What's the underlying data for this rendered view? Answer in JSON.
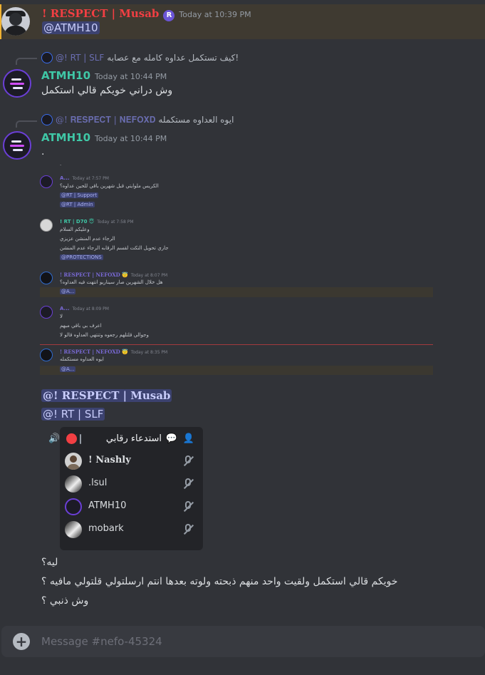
{
  "messages": [
    {
      "author": "! 𝐑𝐄𝐒𝐏𝐄𝐂𝐓 | Musab",
      "badge": "R",
      "time": "Today at 10:39 PM",
      "mention": "@ATMH10"
    },
    {
      "reply": {
        "name": "@! RT | SLF",
        "text": "كيف تستكمل عداوه كامله مع عصابه!"
      },
      "author": "ATMH10",
      "time": "Today at 10:44 PM",
      "text": "وش دراني خويكم قالي استكمل"
    },
    {
      "reply": {
        "name": "@! 𝐑𝐄𝐒𝐏𝐄𝐂𝐓 | 𝐍𝐄𝐅𝐎𝐗𝐃",
        "text": "ايوه العداوه مستكمله"
      },
      "author": "ATMH10",
      "time": "Today at 10:44 PM",
      "text": "."
    }
  ],
  "embed": {
    "top_dot": ".",
    "rows": [
      {
        "name": "A...",
        "time": "Today at 7:57 PM",
        "lines": [
          "الكريس ملوايتي قبل شهرين باقي للحين عداوه؟"
        ],
        "mentions": [
          "@RT | Support",
          "@RT | Admin"
        ]
      },
      {
        "name": "! RT | D70 😇",
        "time": "Today at 7:58 PM",
        "lines": [
          "وعليكم السلام",
          "الرجاء عدم المنشن عزيزي",
          "جاري تحويل التكت لقسم الرقابه الرجاء عدم المنشن"
        ],
        "mentions": [
          "@PROTECTIONS"
        ]
      },
      {
        "name": "! RESPECT | NEFOXD 😇",
        "time": "Today at 8:07 PM",
        "lines": [
          "هل خلال الشهرين صار سيناريو انتهت فيه العداوه؟"
        ],
        "mentions": [
          "@A..."
        ]
      },
      {
        "name": "A...",
        "time": "Today at 8:09 PM",
        "lines": [
          "لا",
          "اعرف بي باقي مبهم",
          "وجوالي قلتلهم رجعوه وتنتهي العداوه قالو لا"
        ],
        "mentions": []
      },
      {
        "name": "! RESPECT | NEFOXD 😇",
        "time": "Today at 8:35 PM",
        "lines": [
          "ايوه العداوه مستكمله"
        ],
        "mentions": [
          "@A..."
        ]
      }
    ]
  },
  "after_embed": {
    "mentions": [
      "@! 𝐑𝐄𝐒𝐏𝐄𝐂𝐓 | Musab",
      "@! RT | SLF"
    ]
  },
  "voice": {
    "title": "استدعاء رقابي",
    "members": [
      {
        "name": "! 𝐍𝐚𝐬𝐡𝐥𝐲"
      },
      {
        "name": ".lsul"
      },
      {
        "name": "ATMH10"
      },
      {
        "name": "mobark"
      }
    ]
  },
  "tail_lines": [
    "ليه؟",
    "خويكم قالي استكمل ولقيت واحد منهم ذبحته ولوته بعدها انتم ارسلتولي قلتولي مافيه ؟",
    "وش ذنبي ؟"
  ],
  "composer": {
    "placeholder": "Message #nefo-45324"
  },
  "colors": {
    "background": "#313338",
    "mention_highlight": "#3f3a31",
    "accent_red": "#f23f43",
    "accent_teal": "#3fc7a6"
  }
}
